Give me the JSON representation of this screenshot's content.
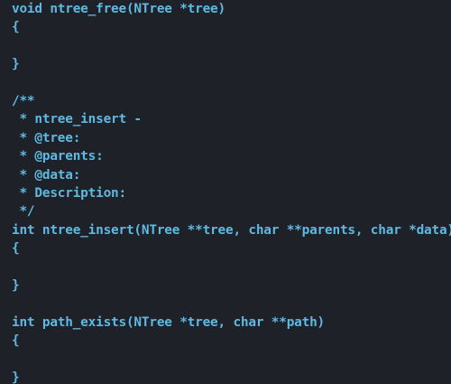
{
  "theme": {
    "background": "#1e2128",
    "code_color": "#5fb9e0",
    "comment_color": "#5fb9e0"
  },
  "editor": {
    "lines": [
      {
        "text": "void ntree_free(NTree *tree)",
        "kind": "code"
      },
      {
        "text": "{",
        "kind": "code"
      },
      {
        "text": "",
        "kind": "code"
      },
      {
        "text": "}",
        "kind": "code"
      },
      {
        "text": "",
        "kind": "code"
      },
      {
        "text": "/**",
        "kind": "comment"
      },
      {
        "text": " * ntree_insert -",
        "kind": "comment"
      },
      {
        "text": " * @tree:",
        "kind": "comment"
      },
      {
        "text": " * @parents:",
        "kind": "comment"
      },
      {
        "text": " * @data:",
        "kind": "comment"
      },
      {
        "text": " * Description:",
        "kind": "comment"
      },
      {
        "text": " */",
        "kind": "comment"
      },
      {
        "text": "int ntree_insert(NTree **tree, char **parents, char *data)",
        "kind": "code"
      },
      {
        "text": "{",
        "kind": "code"
      },
      {
        "text": "",
        "kind": "code"
      },
      {
        "text": "}",
        "kind": "code"
      },
      {
        "text": "",
        "kind": "code"
      },
      {
        "text": "int path_exists(NTree *tree, char **path)",
        "kind": "code"
      },
      {
        "text": "{",
        "kind": "code"
      },
      {
        "text": "",
        "kind": "code"
      },
      {
        "text": "}",
        "kind": "code"
      }
    ]
  }
}
